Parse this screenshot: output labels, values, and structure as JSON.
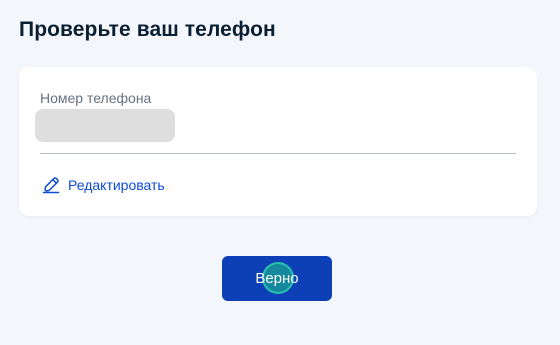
{
  "page": {
    "title": "Проверьте ваш телефон"
  },
  "phone_card": {
    "label": "Номер телефона",
    "value": "",
    "edit_label": "Редактировать"
  },
  "actions": {
    "confirm_label": "Верно"
  },
  "icons": {
    "edit": "pencil-icon",
    "click_marker": "click-indicator"
  },
  "colors": {
    "background": "#f3f6fb",
    "card": "#ffffff",
    "title": "#0b1f33",
    "label": "#66727f",
    "link": "#0d4cd3",
    "button": "#0d3fb6",
    "click_indicator": "#1ba593"
  }
}
